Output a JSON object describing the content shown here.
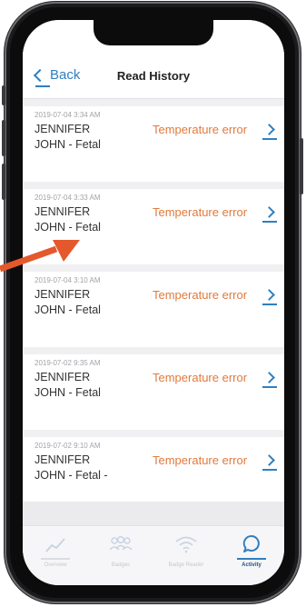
{
  "header": {
    "back_label": "Back",
    "title": "Read History"
  },
  "records": [
    {
      "date": "2019-07-04 3:34 AM",
      "name_line1": "JENNIFER",
      "name_line2": "JOHN - Fetal",
      "status": "Temperature error"
    },
    {
      "date": "2019-07-04 3:33 AM",
      "name_line1": "JENNIFER",
      "name_line2": "JOHN - Fetal",
      "status": "Temperature error"
    },
    {
      "date": "2019-07-04 3:10 AM",
      "name_line1": "JENNIFER",
      "name_line2": "JOHN - Fetal",
      "status": "Temperature error"
    },
    {
      "date": "2019-07-02 9:35 AM",
      "name_line1": "JENNIFER",
      "name_line2": "JOHN - Fetal",
      "status": "Temperature error"
    },
    {
      "date": "2019-07-02 9:10 AM",
      "name_line1": "JENNIFER",
      "name_line2": "JOHN - Fetal  -",
      "status": "Temperature error"
    }
  ],
  "tabs": [
    {
      "label": "Overview",
      "icon": "chart-line-icon",
      "active": false
    },
    {
      "label": "Badges",
      "icon": "people-group-icon",
      "active": false
    },
    {
      "label": "Badge Reader",
      "icon": "wifi-signal-icon",
      "active": false
    },
    {
      "label": "Activity",
      "icon": "chat-bubble-icon",
      "active": true
    }
  ],
  "colors": {
    "accent": "#2f7fc1",
    "status_error": "#e07a3c",
    "annotation_arrow": "#e4582b"
  }
}
